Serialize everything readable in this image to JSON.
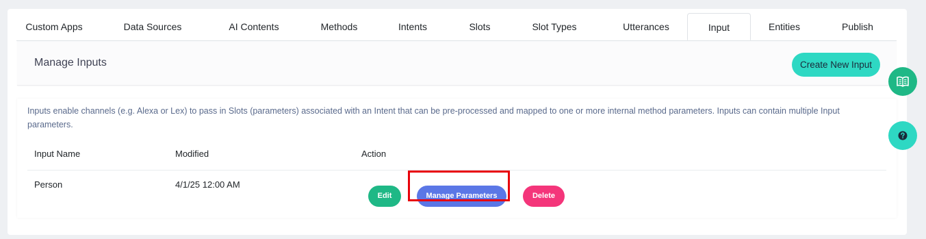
{
  "tabs": [
    {
      "label": "Custom Apps"
    },
    {
      "label": "Data Sources"
    },
    {
      "label": "AI Contents"
    },
    {
      "label": "Methods"
    },
    {
      "label": "Intents"
    },
    {
      "label": "Slots"
    },
    {
      "label": "Slot Types"
    },
    {
      "label": "Utterances"
    },
    {
      "label": "Input",
      "active": true
    },
    {
      "label": "Entities"
    },
    {
      "label": "Publish"
    }
  ],
  "header": {
    "title": "Manage Inputs",
    "create_button": "Create New Input"
  },
  "content": {
    "description": "Inputs enable channels (e.g. Alexa or Lex) to pass in Slots (parameters) associated with an Intent that can be pre-processed and mapped to one or more internal method parameters. Inputs can contain multiple Input parameters.",
    "columns": [
      "Input Name",
      "Modified",
      "Action"
    ],
    "rows": [
      {
        "name": "Person",
        "modified": "4/1/25 12:00 AM",
        "actions": {
          "edit": "Edit",
          "manage": "Manage Parameters",
          "delete": "Delete"
        }
      }
    ]
  },
  "floating": {
    "book_icon": "book-open-icon",
    "help_icon": "question-circle-icon"
  },
  "colors": {
    "accent_teal": "#2ed8c3",
    "edit_green": "#1fb886",
    "manage_blue": "#5b77e6",
    "delete_pink": "#f4357a",
    "highlight_red": "#e8000b"
  }
}
